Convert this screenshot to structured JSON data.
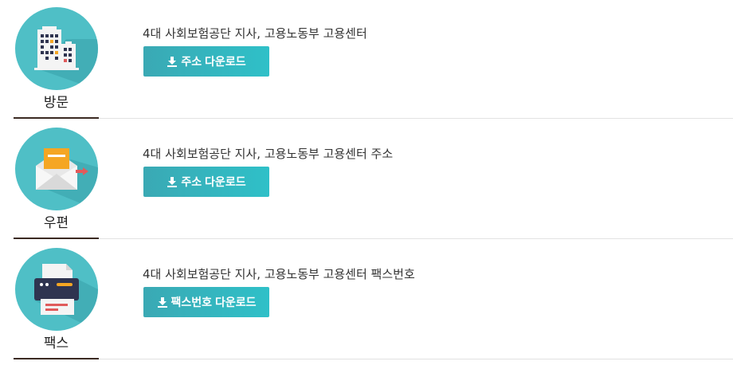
{
  "rows": [
    {
      "caption": "방문",
      "icon": "building-icon",
      "description": "4대 사회보험공단 지사, 고용노동부 고용센터",
      "button_label": "주소 다운로드"
    },
    {
      "caption": "우편",
      "icon": "envelope-icon",
      "description": "4대 사회보험공단 지사, 고용노동부 고용센터 주소",
      "button_label": "주소 다운로드"
    },
    {
      "caption": "팩스",
      "icon": "fax-icon",
      "description": "4대 사회보험공단 지사, 고용노동부 고용센터 팩스번호",
      "button_label": "팩스번호 다운로드"
    }
  ],
  "colors": {
    "circle": "#4fbfc6",
    "button": "#33b5bf",
    "divider_accent": "#3b2a22"
  }
}
